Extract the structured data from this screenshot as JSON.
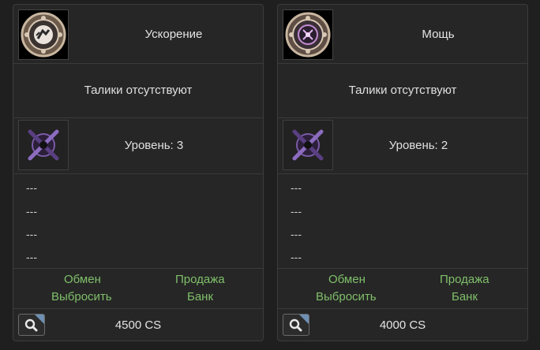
{
  "cards": [
    {
      "skill_name": "Ускорение",
      "talisman_status": "Талики отсутствуют",
      "level_text": "Уровень: 3",
      "stats": [
        "---",
        "---",
        "---",
        "---"
      ],
      "actions": {
        "exchange": "Обмен",
        "sell": "Продажа",
        "discard": "Выбросить",
        "bank": "Банк"
      },
      "price": "4500 CS",
      "skill_icon": "speed-seal-icon",
      "level_icon": "crossed-blades-icon"
    },
    {
      "skill_name": "Мощь",
      "talisman_status": "Талики отсутствуют",
      "level_text": "Уровень: 2",
      "stats": [
        "---",
        "---",
        "---",
        "---"
      ],
      "actions": {
        "exchange": "Обмен",
        "sell": "Продажа",
        "discard": "Выбросить",
        "bank": "Банк"
      },
      "price": "4000 CS",
      "skill_icon": "power-seal-icon",
      "level_icon": "crossed-blades-icon"
    }
  ],
  "colors": {
    "action_link": "#7fbf6a",
    "card_bg": "#262626",
    "page_bg": "#1f1f1f"
  }
}
